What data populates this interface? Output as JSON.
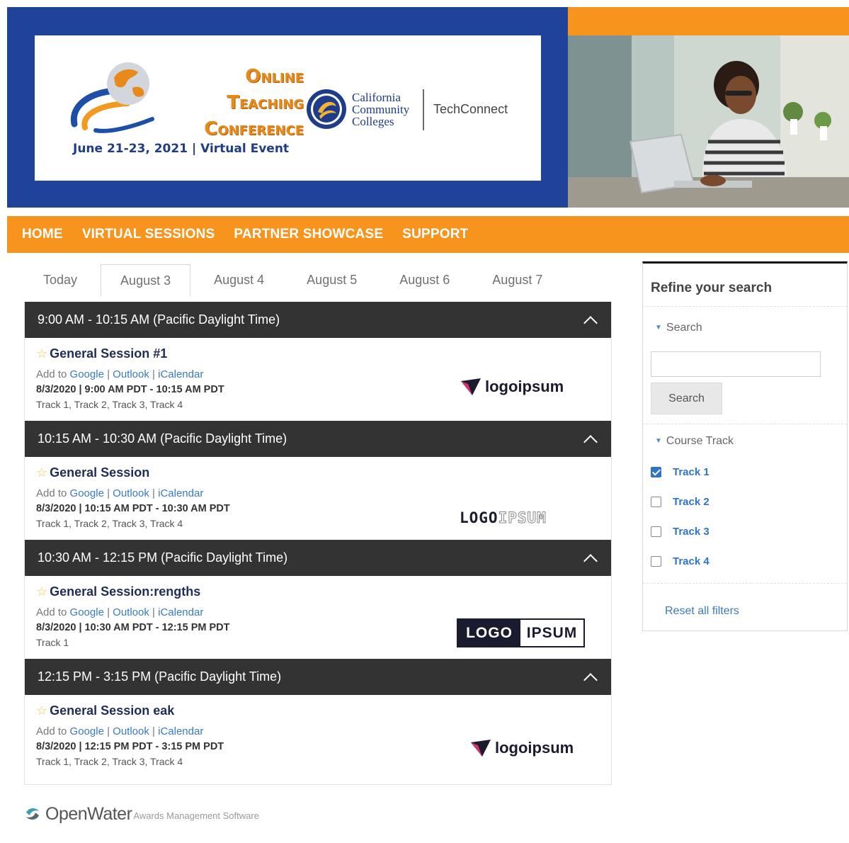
{
  "banner": {
    "conference_title_line1": "Online",
    "conference_title_line2": "Teaching",
    "conference_title_line3": "Conference",
    "conference_date": "June 21-23, 2021 | Virtual Event",
    "ccc_line1": "California",
    "ccc_line2": "Community",
    "ccc_line3": "Colleges",
    "partner": "TechConnect"
  },
  "nav": {
    "items": [
      "HOME",
      "VIRTUAL SESSIONS",
      "PARTNER SHOWCASE",
      "SUPPORT"
    ]
  },
  "tabs": [
    {
      "label": "Today",
      "active": false
    },
    {
      "label": "August 3",
      "active": true
    },
    {
      "label": "August 4",
      "active": false
    },
    {
      "label": "August 5",
      "active": false
    },
    {
      "label": "August 6",
      "active": false
    },
    {
      "label": "August 7",
      "active": false
    }
  ],
  "calendar_links": {
    "prefix": "Add to",
    "google": "Google",
    "outlook": "Outlook",
    "icalendar": "iCalendar",
    "separator": "|"
  },
  "slots": [
    {
      "header": "9:00 AM - 10:15 AM (Pacific Daylight Time)",
      "title": "General Session #1",
      "datetime": "8/3/2020 | 9:00 AM PDT - 10:15 AM PDT",
      "tracks": "Track 1, Track 2, Track 3, Track 4",
      "sponsor_logo": "logoipsum"
    },
    {
      "header": "10:15 AM - 10:30 AM (Pacific Daylight Time)",
      "title": "General Session",
      "datetime": "8/3/2020 | 10:15 AM PDT - 10:30 AM PDT",
      "tracks": "Track 1, Track 2, Track 3, Track 4",
      "sponsor_logo_a": "LOGO",
      "sponsor_logo_b": "IPSUM"
    },
    {
      "header": "10:30 AM - 12:15 PM (Pacific Daylight Time)",
      "title": "General Session:rengths",
      "datetime": "8/3/2020 | 10:30 AM PDT - 12:15 PM PDT",
      "tracks": "Track 1",
      "sponsor_logo_a": "LOGO",
      "sponsor_logo_b": "IPSUM"
    },
    {
      "header": "12:15 PM - 3:15 PM (Pacific Daylight Time)",
      "title": "General Session eak",
      "datetime": "8/3/2020 | 12:15 PM PDT - 3:15 PM PDT",
      "tracks": "Track 1, Track 2, Track 3, Track 4",
      "sponsor_logo": "logoipsum"
    }
  ],
  "refine": {
    "title": "Refine your search",
    "search_section": "Search",
    "search_value": "",
    "search_button": "Search",
    "track_section": "Course Track",
    "tracks": [
      {
        "label": "Track 1",
        "checked": true
      },
      {
        "label": "Track 2",
        "checked": false
      },
      {
        "label": "Track 3",
        "checked": false
      },
      {
        "label": "Track 4",
        "checked": false
      }
    ],
    "reset": "Reset all filters"
  },
  "footer": {
    "brand": "OpenWater",
    "tagline": "Awards Management Software"
  },
  "colors": {
    "brand_blue": "#1e4398",
    "brand_orange": "#f7941d",
    "slot_header": "#333333",
    "link_blue": "#3a7ac0"
  }
}
